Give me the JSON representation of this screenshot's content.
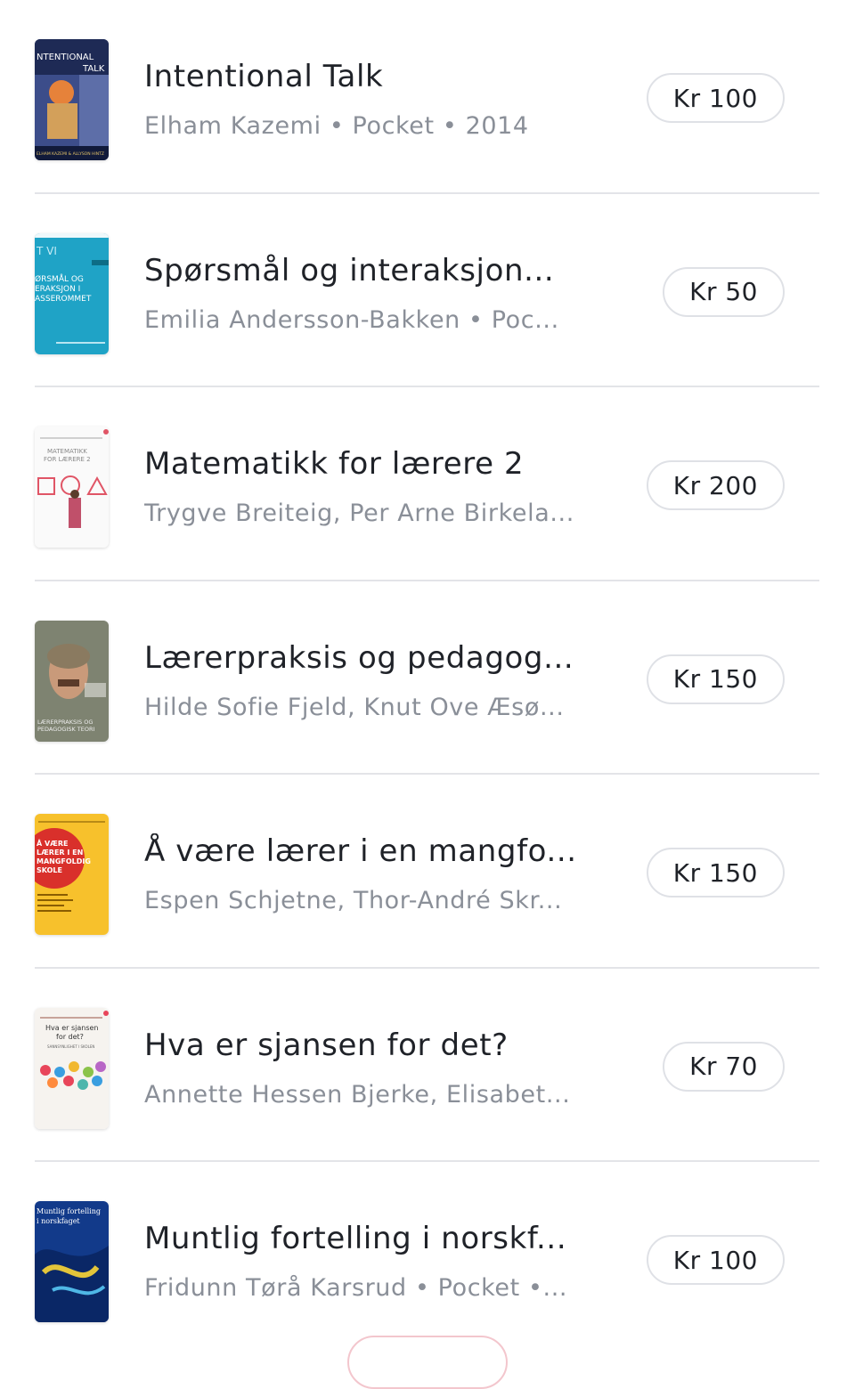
{
  "books": [
    {
      "title": "Intentional Talk",
      "meta": "Elham Kazemi • Pocket • 2014",
      "price": "Kr 100",
      "cover": {
        "lines": [
          "NTENTIONAL",
          "TALK"
        ],
        "footer": "ELHAM KAZEMI & ALLYSON HINTZ",
        "bg": "#3c4d8a",
        "accent": "#e6823a"
      }
    },
    {
      "title": "Spørsmål og interaksjon...",
      "meta": "Emilia Andersson-Bakken • Poc...",
      "price": "Kr 50",
      "cover": {
        "lines": [
          "T VI",
          "ØRSMÅL OG",
          "ERAKSJON I",
          "ASSEROMMET"
        ],
        "bg": "#1fa3c6",
        "accent": "#0d6d86"
      }
    },
    {
      "title": "Matematikk for lærere 2",
      "meta": "Trygve Breiteig, Per Arne Birkela...",
      "price": "Kr 200",
      "cover": {
        "lines": [
          "MATEMATIKK",
          "FOR LÆRERE 2"
        ],
        "bg": "#fafafa",
        "accent": "#e05566"
      }
    },
    {
      "title": "Lærerpraksis og pedagog...",
      "meta": "Hilde Sofie Fjeld, Knut Ove Æsø...",
      "price": "Kr 150",
      "cover": {
        "lines": [
          "LÆRERPRAKSIS OG",
          "PEDAGOGISK TEORI"
        ],
        "bg": "#6f7564",
        "accent": "#c99a7a"
      }
    },
    {
      "title": "Å være lærer i en mangfo...",
      "meta": "Espen Schjetne, Thor-André Skr...",
      "price": "Kr 150",
      "cover": {
        "lines": [
          "Å VÆRE",
          "LÆRER I EN",
          "MANGFOLDIG",
          "SKOLE"
        ],
        "bg": "#f7c12c",
        "accent": "#d9302b"
      }
    },
    {
      "title": "Hva er sjansen for det?",
      "meta": "Annette Hessen Bjerke, Elisabet...",
      "price": "Kr 70",
      "cover": {
        "lines": [
          "Hva er sjansen",
          "for det?",
          "SANNSYNLIGHET I SKOLEN"
        ],
        "bg": "#f6f3ef",
        "accent": "#e8455a"
      }
    },
    {
      "title": "Muntlig fortelling i norskf...",
      "meta": "Fridunn Tørå Karsrud • Pocket •...",
      "price": "Kr 100",
      "cover": {
        "lines": [
          "Muntlig fortelling",
          "i norskfaget"
        ],
        "bg": "#123a8a",
        "accent": "#e3c53a"
      }
    }
  ]
}
